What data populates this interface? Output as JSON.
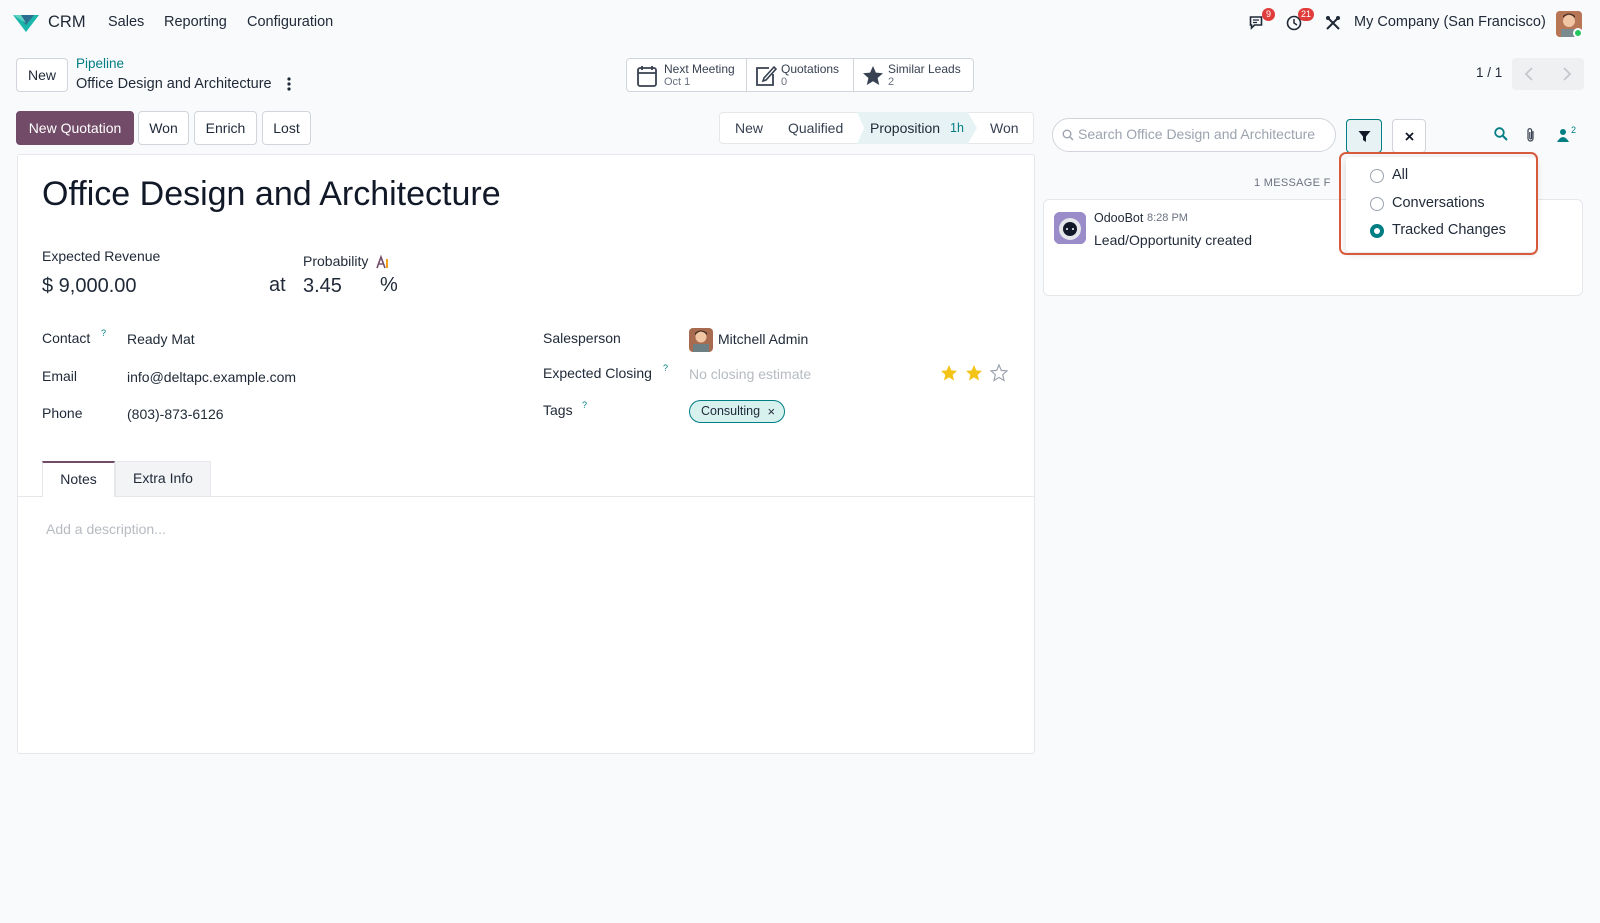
{
  "nav": {
    "app_name": "CRM",
    "menu": [
      "Sales",
      "Reporting",
      "Configuration"
    ],
    "messages_badge": "9",
    "activities_badge": "21",
    "company": "My Company (San Francisco)"
  },
  "control": {
    "new_label": "New",
    "breadcrumb_parent": "Pipeline",
    "record_title": "Office Design and Architecture",
    "pager": "1 / 1"
  },
  "smart_buttons": [
    {
      "label": "Next Meeting",
      "value": "Oct 1",
      "icon": "calendar-icon"
    },
    {
      "label": "Quotations",
      "value": "0",
      "icon": "edit-icon"
    },
    {
      "label": "Similar Leads",
      "value": "2",
      "icon": "star-icon"
    }
  ],
  "actions": {
    "new_quotation": "New Quotation",
    "won": "Won",
    "enrich": "Enrich",
    "lost": "Lost"
  },
  "stages": {
    "items": [
      "New",
      "Qualified",
      "Proposition",
      "Won"
    ],
    "active": "Proposition",
    "active_duration": "1h"
  },
  "form": {
    "title": "Office Design and Architecture",
    "expected_revenue_label": "Expected Revenue",
    "expected_revenue": "$ 9,000.00",
    "at": "at",
    "probability_label": "Probability",
    "probability": "3.45",
    "percent": "%",
    "contact_label": "Contact",
    "contact": "Ready Mat",
    "email_label": "Email",
    "email": "info@deltapc.example.com",
    "phone_label": "Phone",
    "phone": "(803)-873-6126",
    "salesperson_label": "Salesperson",
    "salesperson": "Mitchell Admin",
    "expected_closing_label": "Expected Closing",
    "expected_closing_placeholder": "No closing estimate",
    "priority_stars": 2,
    "priority_max": 3,
    "tags_label": "Tags",
    "tags": [
      "Consulting"
    ],
    "help_mark": "?"
  },
  "tabs": {
    "items": [
      "Notes",
      "Extra Info"
    ],
    "active": "Notes",
    "description_placeholder": "Add a description..."
  },
  "chatter": {
    "search_placeholder": "Search Office Design and Architecture",
    "followers_count": "2",
    "messages_found": "1 MESSAGE F",
    "message": {
      "author": "OdooBot",
      "time": "8:28 PM",
      "body": "Lead/Opportunity created"
    },
    "filter_options": [
      "All",
      "Conversations",
      "Tracked Changes"
    ],
    "filter_selected": "Tracked Changes"
  },
  "colors": {
    "primary": "#714b67",
    "accent": "#017e84",
    "badge": "#e03c3c",
    "star": "#f3c316",
    "highlight": "#d75a3c"
  }
}
